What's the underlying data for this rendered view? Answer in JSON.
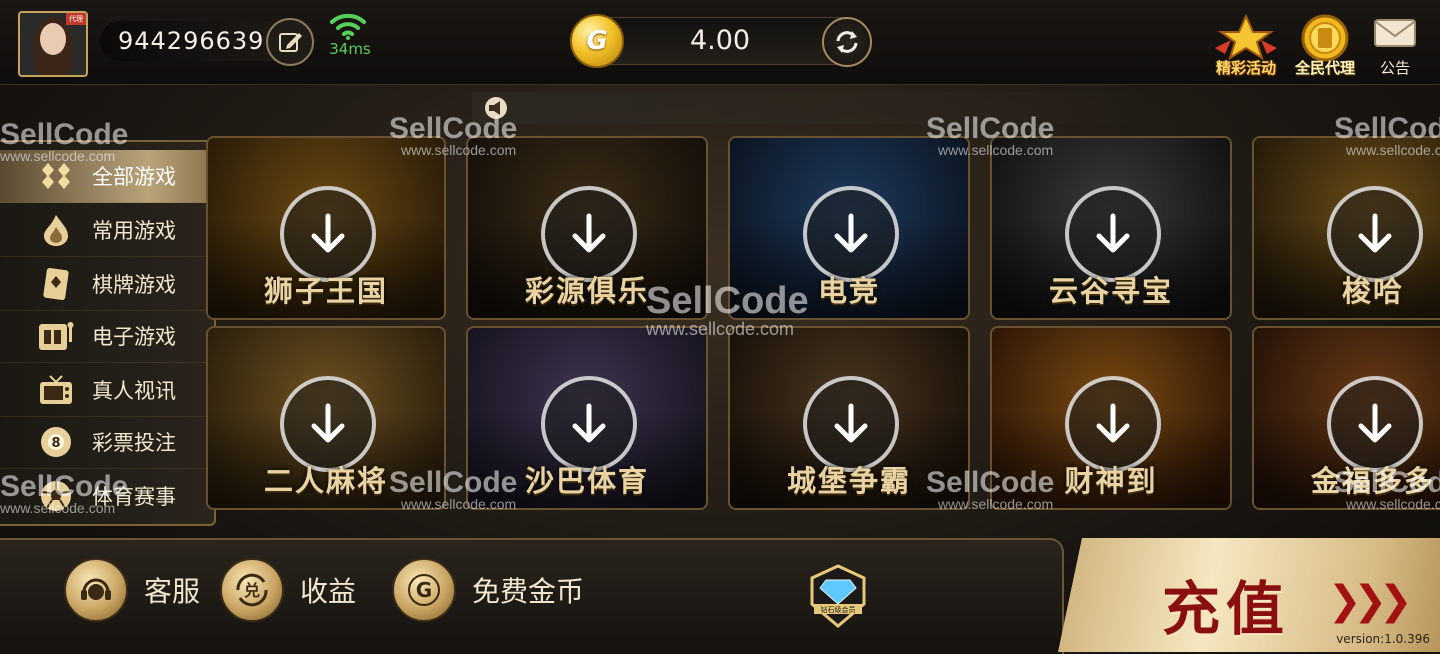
{
  "header": {
    "avatar_badge": "代理",
    "user_id": "944296639",
    "ping": "34ms",
    "balance": "4.00",
    "coin_symbol": "G",
    "icons": [
      {
        "name": "activity",
        "label": "精彩活动"
      },
      {
        "name": "agent",
        "label": "全民代理"
      },
      {
        "name": "notice",
        "label": "公告"
      }
    ]
  },
  "sidebar": {
    "items": [
      {
        "label": "全部游戏",
        "icon": "all-games-icon",
        "active": true
      },
      {
        "label": "常用游戏",
        "icon": "flame-icon"
      },
      {
        "label": "棋牌游戏",
        "icon": "cards-icon"
      },
      {
        "label": "电子游戏",
        "icon": "slot-machine-icon"
      },
      {
        "label": "真人视讯",
        "icon": "tv-icon"
      },
      {
        "label": "彩票投注",
        "icon": "lottery-ball-icon"
      },
      {
        "label": "体育赛事",
        "icon": "soccer-ball-icon"
      }
    ]
  },
  "games": [
    {
      "name": "狮子王国",
      "colors": [
        "#6b4a12",
        "#2a1c08"
      ]
    },
    {
      "name": "彩源俱乐",
      "colors": [
        "#3c2c16",
        "#15100a"
      ]
    },
    {
      "name": "电竞",
      "colors": [
        "#1d3a5c",
        "#0c1522"
      ]
    },
    {
      "name": "云谷寻宝",
      "colors": [
        "#3a3a3a",
        "#121212"
      ]
    },
    {
      "name": "梭哈",
      "colors": [
        "#6a4c16",
        "#241a0a"
      ]
    },
    {
      "name": "二人麻将",
      "colors": [
        "#6e5220",
        "#2a1e0c"
      ]
    },
    {
      "name": "沙巴体育",
      "colors": [
        "#3e3450",
        "#181420"
      ]
    },
    {
      "name": "城堡争霸",
      "colors": [
        "#4a3620",
        "#191108"
      ]
    },
    {
      "name": "财神到",
      "colors": [
        "#7a4a12",
        "#2e1606"
      ]
    },
    {
      "name": "金福多多",
      "colors": [
        "#6a3a14",
        "#241208"
      ]
    }
  ],
  "bottom": {
    "service": "客服",
    "earnings": "收益",
    "earnings_icon_text": "兑",
    "free_coins": "免费金币",
    "vip_badge_text": "钻石级会员",
    "recharge": "充值",
    "version": "version:1.0.396"
  },
  "watermark": {
    "brand": "SellCode",
    "url": "www.sellcode.com"
  }
}
